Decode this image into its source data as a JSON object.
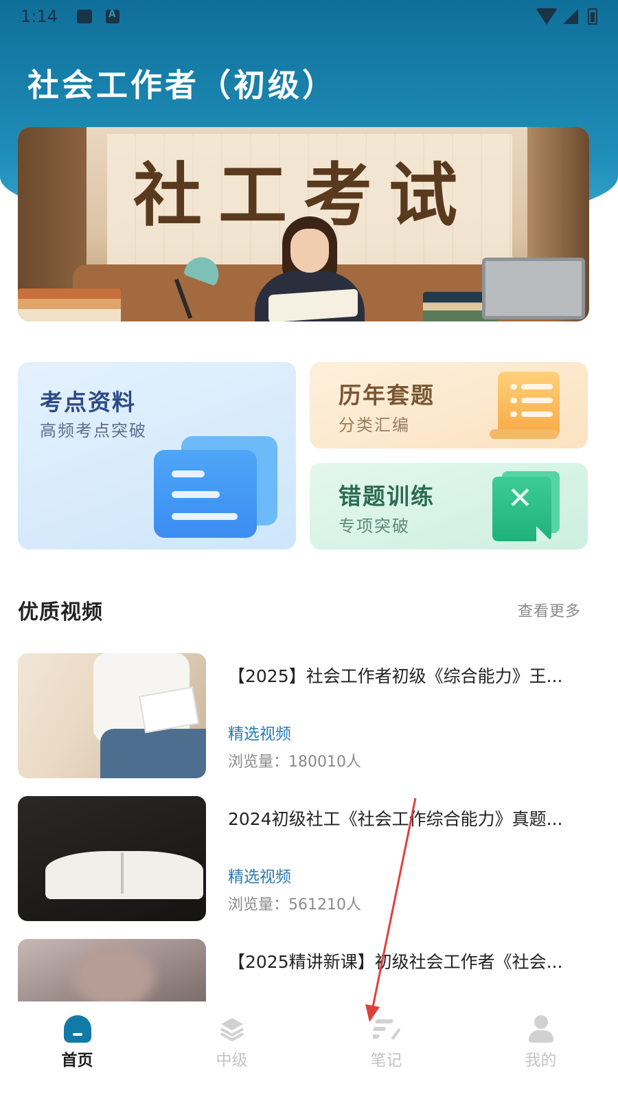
{
  "status_bar": {
    "time": "1:14"
  },
  "header": {
    "title": "社会工作者（初级）"
  },
  "banner": {
    "title": "社工考试"
  },
  "cards": {
    "key_points": {
      "title": "考点资料",
      "subtitle": "高频考点突破"
    },
    "past_papers": {
      "title": "历年套题",
      "subtitle": "分类汇编"
    },
    "wrong_questions": {
      "title": "错题训练",
      "subtitle": "专项突破"
    }
  },
  "videos_section": {
    "title": "优质视频",
    "more_label": "查看更多",
    "items": [
      {
        "title": "【2025】社会工作者初级《综合能力》王...",
        "tag": "精选视频",
        "views": "浏览量：180010人"
      },
      {
        "title": "2024初级社工《社会工作综合能力》真题...",
        "tag": "精选视频",
        "views": "浏览量：561210人"
      },
      {
        "title": "【2025精讲新课】初级社会工作者《社会...",
        "tag": "",
        "views": ""
      }
    ]
  },
  "tabbar": {
    "tabs": [
      {
        "label": "首页",
        "icon": "home-icon",
        "active": true
      },
      {
        "label": "中级",
        "icon": "layers-icon",
        "active": false
      },
      {
        "label": "笔记",
        "icon": "notes-icon",
        "active": false
      },
      {
        "label": "我的",
        "icon": "user-icon",
        "active": false
      }
    ]
  },
  "colors": {
    "header_blue": "#1f8fb9",
    "active_tab": "#127aa6",
    "video_tag": "#2b7bb3",
    "annotation_arrow": "#e0403a"
  }
}
